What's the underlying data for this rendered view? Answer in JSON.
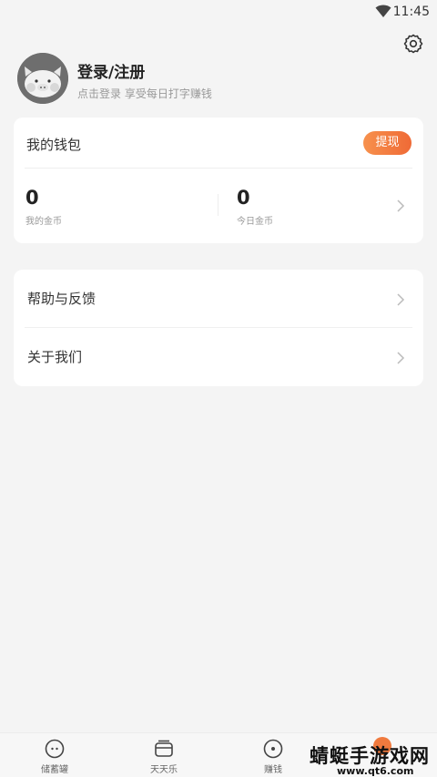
{
  "status_bar": {
    "time": "11:45",
    "wifi_icon": "wifi-icon"
  },
  "settings": {
    "icon": "gear-icon"
  },
  "profile": {
    "avatar_icon": "pig-avatar",
    "title": "登录/注册",
    "subtitle": "点击登录 享受每日打字赚钱"
  },
  "wallet": {
    "title": "我的钱包",
    "withdraw_label": "提现",
    "coins": {
      "value": "0",
      "label": "我的金币"
    },
    "today": {
      "value": "0",
      "label": "今日金币"
    }
  },
  "menu": {
    "items": [
      {
        "label": "帮助与反馈"
      },
      {
        "label": "关于我们"
      }
    ]
  },
  "bottom_nav": {
    "items": [
      {
        "label": "储蓄罐",
        "icon": "piggy-bank-icon"
      },
      {
        "label": "天天乐",
        "icon": "card-icon"
      },
      {
        "label": "赚钱",
        "icon": "coin-circle-icon"
      },
      {
        "label": "",
        "icon": "profile-icon"
      }
    ]
  },
  "watermark": {
    "main": "蜻蜓手游戏网",
    "url": "www.qt6.com"
  },
  "colors": {
    "accent": "#ef6a36",
    "background": "#f4f4f4",
    "card": "#ffffff"
  }
}
